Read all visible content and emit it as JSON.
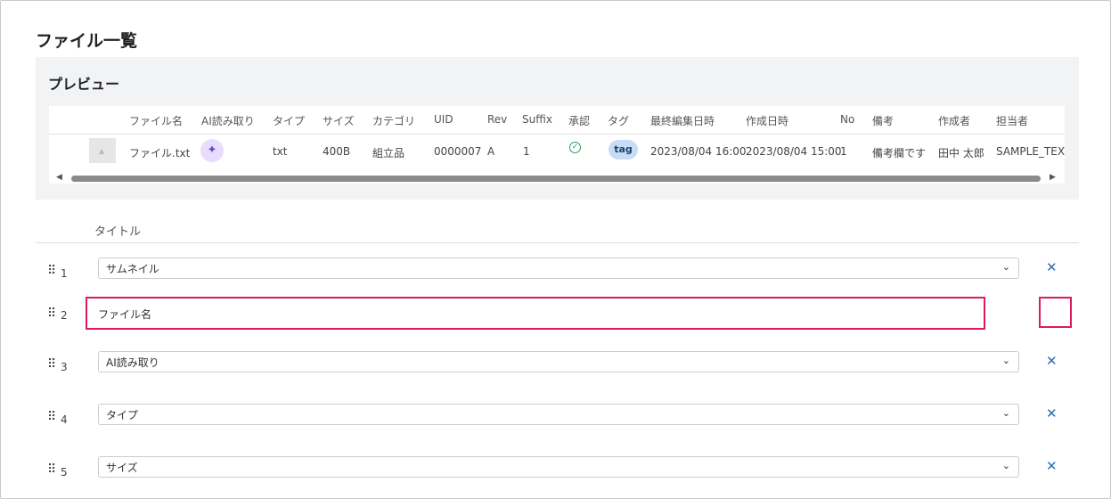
{
  "page_title": "ファイル一覧",
  "preview": {
    "title": "プレビュー",
    "columns": [
      "ファイル名",
      "AI読み取り",
      "タイプ",
      "サイズ",
      "カテゴリ",
      "UID",
      "Rev",
      "Suffix",
      "承認",
      "タグ",
      "最終編集日時",
      "作成日時",
      "No",
      "備考",
      "作成者",
      "担当者"
    ],
    "row": {
      "file_name": "ファイル.txt",
      "ai_icon": "sparkle-icon",
      "type": "txt",
      "size": "400B",
      "category": "組立品",
      "uid": "0000007",
      "rev": "A",
      "suffix": "1",
      "approval_icon": "check-circle-icon",
      "tag": "tag",
      "last_edited": "2023/08/04 16:00",
      "created": "2023/08/04 15:00",
      "no": "1",
      "note": "備考欄です",
      "creator": "田中 太郎",
      "assignee": "SAMPLE_TEXT"
    }
  },
  "list": {
    "header_title": "タイトル",
    "rows": [
      {
        "num": "1",
        "value": "サムネイル",
        "kind": "select"
      },
      {
        "num": "2",
        "value": "ファイル名",
        "kind": "text"
      },
      {
        "num": "3",
        "value": "AI読み取り",
        "kind": "select"
      },
      {
        "num": "4",
        "value": "タイプ",
        "kind": "select"
      },
      {
        "num": "5",
        "value": "サイズ",
        "kind": "select"
      }
    ]
  },
  "colors": {
    "accent_pink": "#e0195a",
    "remove_blue": "#2d6db4",
    "approve_green": "#2c9c5b",
    "tag_bg": "#c9dcf5",
    "ai_bg": "#e8dcff"
  }
}
